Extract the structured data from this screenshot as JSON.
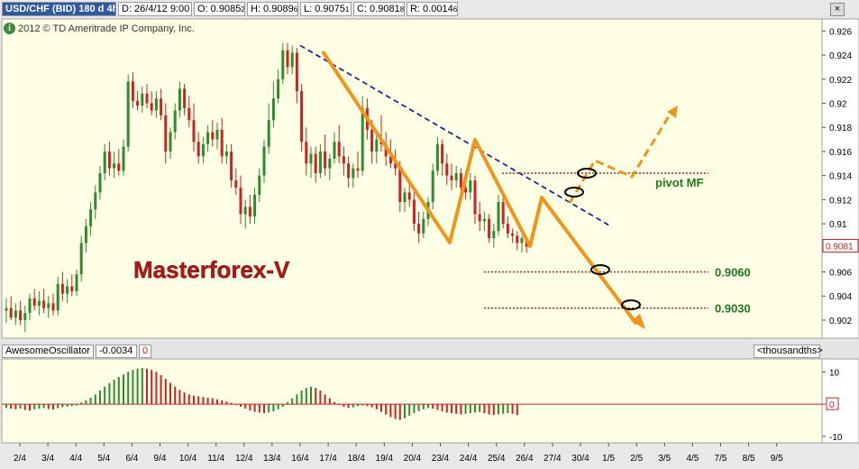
{
  "header": {
    "symbol": "USD/CHF (BID) 180 d 4h",
    "date": "D: 26/4/12 9:00",
    "open": "O: 0.9085",
    "open_sub": "2",
    "high": "H: 0.9089",
    "high_sub": "6",
    "low": "L: 0.9075",
    "low_sub": "1",
    "close": "C: 0.9081",
    "close_sub": "8",
    "range": "R: 0.0014",
    "range_sub": "6",
    "close_button": "×"
  },
  "copyright": "2012 © TD Ameritrade IP Company, Inc.",
  "indicator": {
    "name": "AwesomeOscillator",
    "value": "-0.0034",
    "zero": "0",
    "units": "<thousandths>"
  },
  "annotations": {
    "watermark": "Masterforex-V",
    "pivot_label": "pivot MF",
    "target1": "0.9060",
    "target2": "0.9030"
  },
  "colors": {
    "bg": "#ffffe6",
    "bull": "#2e8b2e",
    "bear": "#cc2222",
    "trend": "#f0951b",
    "dash": "#1c2a8a",
    "level": "#cc2222",
    "watermark": "#b01818",
    "target": "#1f7a1f"
  },
  "chart_data": [
    {
      "type": "candlestick",
      "title": "USD/CHF (BID) 180 d 4h",
      "y_ticks": [
        "0.902",
        "0.904",
        "0.906",
        "0.908",
        "0.91",
        "0.912",
        "0.914",
        "0.916",
        "0.918",
        "0.92",
        "0.922",
        "0.924",
        "0.926"
      ],
      "ylim": [
        0.9005,
        0.927
      ],
      "x_ticks": [
        "2/4",
        "3/4",
        "4/4",
        "5/4",
        "6/4",
        "9/4",
        "10/4",
        "11/4",
        "12/4",
        "13/4",
        "16/4",
        "17/4",
        "18/4",
        "19/4",
        "20/4",
        "23/4",
        "24/4",
        "25/4",
        "26/4",
        "27/4",
        "30/4",
        "1/5",
        "2/5",
        "3/5",
        "4/5",
        "7/5",
        "8/5",
        "9/5"
      ],
      "last_price": "0.9081",
      "resistance_line": {
        "from": [
          "16/4",
          0.9248
        ],
        "to": [
          "1/5",
          0.9099
        ]
      },
      "pivot_level": {
        "label": "pivot MF",
        "value": 0.9142
      },
      "target_levels": [
        {
          "label": "0.9060",
          "value": 0.906
        },
        {
          "label": "0.9030",
          "value": 0.903
        }
      ],
      "candles": [
        [
          0.9028,
          0.9038,
          0.9018,
          0.903
        ],
        [
          0.903,
          0.904,
          0.902,
          0.9022
        ],
        [
          0.9022,
          0.9034,
          0.9016,
          0.9028
        ],
        [
          0.9028,
          0.9036,
          0.9016,
          0.902
        ],
        [
          0.902,
          0.9032,
          0.901,
          0.9026
        ],
        [
          0.9026,
          0.9042,
          0.902,
          0.9038
        ],
        [
          0.9038,
          0.9046,
          0.9028,
          0.9032
        ],
        [
          0.9032,
          0.9044,
          0.9024,
          0.9036
        ],
        [
          0.9036,
          0.9046,
          0.9026,
          0.903
        ],
        [
          0.903,
          0.904,
          0.9022,
          0.9034
        ],
        [
          0.9034,
          0.9042,
          0.9024,
          0.9028
        ],
        [
          0.9028,
          0.9056,
          0.9024,
          0.905
        ],
        [
          0.905,
          0.906,
          0.9036,
          0.9042
        ],
        [
          0.9042,
          0.9054,
          0.9034,
          0.9048
        ],
        [
          0.9048,
          0.9058,
          0.904,
          0.9044
        ],
        [
          0.9044,
          0.9062,
          0.904,
          0.9058
        ],
        [
          0.9058,
          0.909,
          0.9052,
          0.9084
        ],
        [
          0.9084,
          0.9104,
          0.9076,
          0.9098
        ],
        [
          0.9098,
          0.9118,
          0.909,
          0.9112
        ],
        [
          0.9112,
          0.9132,
          0.9104,
          0.9126
        ],
        [
          0.9126,
          0.9148,
          0.912,
          0.9142
        ],
        [
          0.9142,
          0.9166,
          0.9136,
          0.916
        ],
        [
          0.916,
          0.9168,
          0.914,
          0.9146
        ],
        [
          0.9146,
          0.916,
          0.9138,
          0.915
        ],
        [
          0.915,
          0.9162,
          0.914,
          0.9144
        ],
        [
          0.9144,
          0.917,
          0.914,
          0.9164
        ],
        [
          0.9164,
          0.9224,
          0.916,
          0.9218
        ],
        [
          0.9218,
          0.9226,
          0.9196,
          0.9202
        ],
        [
          0.9202,
          0.921,
          0.9194,
          0.9198
        ],
        [
          0.9198,
          0.9214,
          0.9192,
          0.9208
        ],
        [
          0.9208,
          0.9216,
          0.9196,
          0.92
        ],
        [
          0.92,
          0.921,
          0.919,
          0.9194
        ],
        [
          0.9194,
          0.921,
          0.9188,
          0.9204
        ],
        [
          0.9204,
          0.9212,
          0.9186,
          0.919
        ],
        [
          0.919,
          0.92,
          0.915,
          0.916
        ],
        [
          0.916,
          0.918,
          0.9154,
          0.9176
        ],
        [
          0.9176,
          0.92,
          0.917,
          0.9194
        ],
        [
          0.9194,
          0.9218,
          0.9188,
          0.9212
        ],
        [
          0.9212,
          0.9216,
          0.919,
          0.9196
        ],
        [
          0.9196,
          0.9206,
          0.918,
          0.9186
        ],
        [
          0.9186,
          0.92,
          0.916,
          0.9168
        ],
        [
          0.9168,
          0.9176,
          0.915,
          0.9156
        ],
        [
          0.9156,
          0.9172,
          0.915,
          0.9166
        ],
        [
          0.9166,
          0.9182,
          0.916,
          0.9176
        ],
        [
          0.9176,
          0.9186,
          0.9164,
          0.917
        ],
        [
          0.917,
          0.9184,
          0.9162,
          0.9178
        ],
        [
          0.9178,
          0.9188,
          0.915,
          0.9156
        ],
        [
          0.9156,
          0.9166,
          0.915,
          0.916
        ],
        [
          0.916,
          0.9166,
          0.913,
          0.9136
        ],
        [
          0.9136,
          0.9146,
          0.9124,
          0.913
        ],
        [
          0.913,
          0.914,
          0.91,
          0.9108
        ],
        [
          0.9108,
          0.912,
          0.9096,
          0.9114
        ],
        [
          0.9114,
          0.9124,
          0.91,
          0.9106
        ],
        [
          0.9106,
          0.913,
          0.91,
          0.9124
        ],
        [
          0.9124,
          0.9146,
          0.9118,
          0.914
        ],
        [
          0.914,
          0.917,
          0.9134,
          0.9164
        ],
        [
          0.9164,
          0.92,
          0.9158,
          0.9186
        ],
        [
          0.9186,
          0.9218,
          0.918,
          0.9204
        ],
        [
          0.9204,
          0.9228,
          0.92,
          0.922
        ],
        [
          0.922,
          0.925,
          0.9216,
          0.9244
        ],
        [
          0.9244,
          0.925,
          0.9224,
          0.923
        ],
        [
          0.923,
          0.9248,
          0.9224,
          0.9242
        ],
        [
          0.9242,
          0.9246,
          0.92,
          0.921
        ],
        [
          0.921,
          0.9216,
          0.916,
          0.9168
        ],
        [
          0.9168,
          0.918,
          0.914,
          0.915
        ],
        [
          0.915,
          0.9164,
          0.9138,
          0.9158
        ],
        [
          0.9158,
          0.9164,
          0.9134,
          0.9142
        ],
        [
          0.9142,
          0.9166,
          0.9138,
          0.916
        ],
        [
          0.916,
          0.9174,
          0.914,
          0.9146
        ],
        [
          0.9146,
          0.9158,
          0.9136,
          0.9154
        ],
        [
          0.9154,
          0.9176,
          0.915,
          0.9168
        ],
        [
          0.9168,
          0.9182,
          0.915,
          0.9156
        ],
        [
          0.9156,
          0.9164,
          0.914,
          0.915
        ],
        [
          0.915,
          0.9156,
          0.913,
          0.9138
        ],
        [
          0.9138,
          0.915,
          0.913,
          0.9146
        ],
        [
          0.9146,
          0.916,
          0.9138,
          0.9144
        ],
        [
          0.9144,
          0.9206,
          0.914,
          0.9196
        ],
        [
          0.9196,
          0.9204,
          0.917,
          0.9178
        ],
        [
          0.9178,
          0.9186,
          0.915,
          0.916
        ],
        [
          0.916,
          0.9174,
          0.915,
          0.917
        ],
        [
          0.917,
          0.919,
          0.916,
          0.9166
        ],
        [
          0.9166,
          0.9176,
          0.9148,
          0.9156
        ],
        [
          0.9156,
          0.917,
          0.9146,
          0.915
        ],
        [
          0.915,
          0.9162,
          0.914,
          0.9146
        ],
        [
          0.9146,
          0.9152,
          0.911,
          0.9118
        ],
        [
          0.9118,
          0.913,
          0.911,
          0.9126
        ],
        [
          0.9126,
          0.9136,
          0.9114,
          0.912
        ],
        [
          0.912,
          0.9126,
          0.9094,
          0.91
        ],
        [
          0.91,
          0.911,
          0.9084,
          0.9092
        ],
        [
          0.9092,
          0.911,
          0.9088,
          0.9104
        ],
        [
          0.9104,
          0.9122,
          0.9098,
          0.9118
        ],
        [
          0.9118,
          0.915,
          0.9112,
          0.9144
        ],
        [
          0.9144,
          0.9172,
          0.914,
          0.9166
        ],
        [
          0.9166,
          0.917,
          0.914,
          0.915
        ],
        [
          0.915,
          0.9158,
          0.9132,
          0.914
        ],
        [
          0.914,
          0.915,
          0.9128,
          0.9136
        ],
        [
          0.9136,
          0.9148,
          0.913,
          0.9142
        ],
        [
          0.9142,
          0.9146,
          0.9124,
          0.913
        ],
        [
          0.913,
          0.9138,
          0.912,
          0.9126
        ],
        [
          0.9126,
          0.9142,
          0.912,
          0.9136
        ],
        [
          0.9136,
          0.914,
          0.91,
          0.9108
        ],
        [
          0.9108,
          0.9118,
          0.9094,
          0.9102
        ],
        [
          0.9102,
          0.911,
          0.9094,
          0.9104
        ],
        [
          0.9104,
          0.9108,
          0.9084,
          0.9088
        ],
        [
          0.9088,
          0.91,
          0.908,
          0.9094
        ],
        [
          0.9094,
          0.9124,
          0.909,
          0.9118
        ],
        [
          0.9118,
          0.9122,
          0.9096,
          0.91
        ],
        [
          0.91,
          0.9106,
          0.9088,
          0.9092
        ],
        [
          0.9092,
          0.9096,
          0.9084,
          0.909
        ],
        [
          0.909,
          0.9094,
          0.9078,
          0.9084
        ],
        [
          0.9084,
          0.909,
          0.9076,
          0.9088
        ],
        [
          0.9088,
          0.909,
          0.9076,
          0.9081
        ]
      ]
    },
    {
      "type": "bar",
      "title": "AwesomeOscillator",
      "ylabel": "<thousandths>",
      "y_ticks": [
        "10",
        "0",
        "-10"
      ],
      "ylim": [
        -12,
        14
      ],
      "series": [
        {
          "values": [
            -1.2,
            -1.4,
            -1.6,
            -1.4,
            -1.8,
            -2.0,
            -1.6,
            -1.4,
            -1.2,
            -1.5,
            -1.7,
            -1.3,
            -1.0,
            -0.8,
            -0.6,
            -0.4,
            0.5,
            1.2,
            2.0,
            3.0,
            4.2,
            5.4,
            6.5,
            7.5,
            8.4,
            9.2,
            10.0,
            10.6,
            11.0,
            11.2,
            11.0,
            10.6,
            10.0,
            9.0,
            7.8,
            6.6,
            5.4,
            4.4,
            3.6,
            3.0,
            2.6,
            2.4,
            2.2,
            2.0,
            1.8,
            1.5,
            1.2,
            0.8,
            0.4,
            -0.2,
            -0.8,
            -1.4,
            -2.0,
            -2.4,
            -2.6,
            -2.8,
            -2.6,
            -2.2,
            -1.6,
            -0.8,
            0.6,
            1.8,
            3.0,
            4.2,
            5.0,
            5.4,
            5.0,
            4.2,
            3.0,
            1.8,
            0.6,
            -0.2,
            -0.8,
            -1.2,
            -1.0,
            -0.6,
            -0.4,
            -0.6,
            -1.0,
            -1.6,
            -2.4,
            -3.2,
            -4.0,
            -4.6,
            -4.9,
            -4.4,
            -3.6,
            -2.8,
            -2.2,
            -1.6,
            -1.2,
            -1.4,
            -1.8,
            -2.2,
            -2.6,
            -2.8,
            -3.0,
            -3.2,
            -3.0,
            -2.8,
            -2.6,
            -2.4,
            -2.8,
            -3.2,
            -3.4,
            -3.2,
            -3.0,
            -2.8,
            -3.0,
            -3.4
          ]
        }
      ]
    }
  ]
}
